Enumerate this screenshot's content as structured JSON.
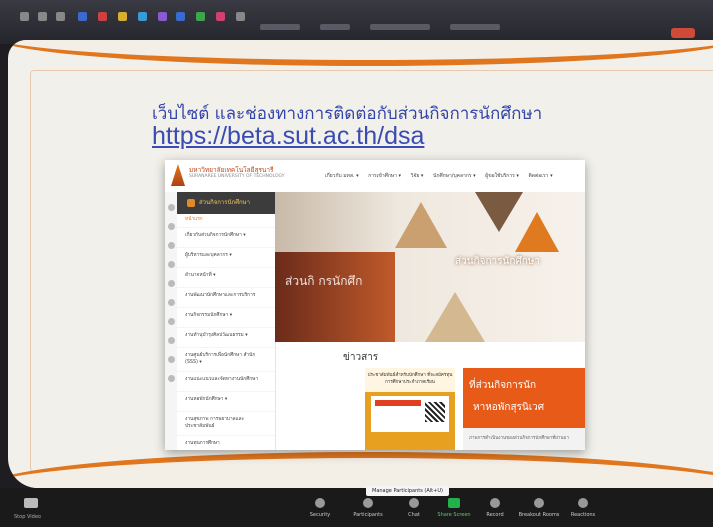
{
  "slide": {
    "heading": "เว็บไซต์ และช่องทางการติดต่อกับส่วนกิจการนักศึกษา",
    "link": "https://beta.sut.ac.th/dsa"
  },
  "website": {
    "university_name_th": "มหาวิทยาลัยเทคโนโลยีสุรนารี",
    "university_name_en": "SURANAREE UNIVERSITY OF TECHNOLOGY",
    "nav": [
      "เกี่ยวกับ มทส. ▾",
      "การเข้าศึกษา ▾",
      "วิจัย ▾",
      "นักศึกษา/บุคลากร ▾",
      "ผู้ขอใช้บริการ ▾",
      "ติดต่อเรา ▾"
    ],
    "sidebar_header": "ส่วนกิจการนักศึกษา",
    "sidebar_items": [
      "หน้าแรก",
      "เกี่ยวกับส่วนกิจการนักศึกษา ▾",
      "ผู้บริหารและบุคลากร ▾",
      "อำนาจหน้าที่ ▾",
      "งานพัฒนานักศึกษาและการบริการ",
      "งานกิจกรรมนักศึกษา ▾",
      "งานทำนุบำรุงศิลปวัฒนธรรม ▾",
      "งานศูนย์บริการเพื่อนักศึกษา สำนัก (SSS) ▾",
      "งานแนะแนวและจัดหางานนักศึกษา",
      "งานหอพักนักศึกษา ▾",
      "งานสุขภาพ การพยาบาลและ ประชาสัมพันธ์",
      "งานทุนการศึกษา"
    ],
    "banner_text_left": "ส่วนกิ กรนักศึก",
    "banner_title": "ส่วนกิจการนักศึกษา",
    "news_title": "ข่าวสาร",
    "card1_text": "ประชาสัมพันธ์สำหรับนักศึกษา ที่จะสมัครทุนการศึกษาประจำภาคเรียน",
    "card2_line1": "ที่ส่วนกิจการนัก",
    "card2_line2": "หาหอพักสุรนิเวศ",
    "card2_caption": "ภาพการดำเนินงานของส่วนกิจการนักศึกษาที่ผ่านมา"
  },
  "toolbar": {
    "stop_video": "Stop Video",
    "security": "Security",
    "participants": "Participants",
    "chat": "Chat",
    "share_screen": "Share Screen",
    "record": "Record",
    "breakout_rooms": "Breakout Rooms",
    "reactions": "Reactions",
    "tooltip": "Manage Participants (Alt+U)"
  },
  "colors": {
    "accent": "#e0761e",
    "link": "#3a4bb2",
    "share_green": "#22b14c"
  }
}
